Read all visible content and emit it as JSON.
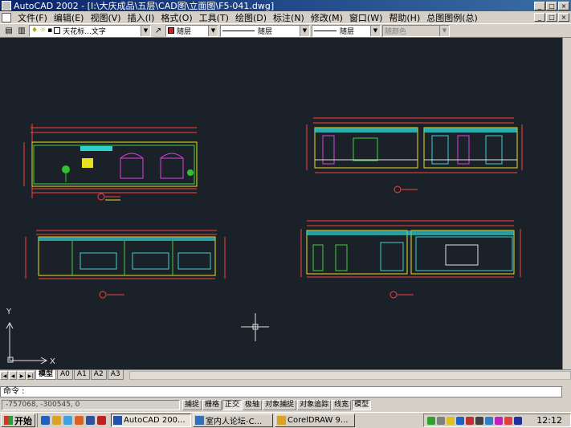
{
  "window": {
    "title": "AutoCAD 2002 - [I:\\大庆成品\\五层\\CAD图\\立面图\\F5-041.dwg]"
  },
  "window_buttons": [
    "_",
    "□",
    "×"
  ],
  "menu": {
    "items": [
      {
        "label": "文件(F)"
      },
      {
        "label": "编辑(E)"
      },
      {
        "label": "视图(V)"
      },
      {
        "label": "插入(I)"
      },
      {
        "label": "格式(O)"
      },
      {
        "label": "工具(T)"
      },
      {
        "label": "绘图(D)"
      },
      {
        "label": "标注(N)"
      },
      {
        "label": "修改(M)"
      },
      {
        "label": "窗口(W)"
      },
      {
        "label": "帮助(H)"
      },
      {
        "label": "总图图例(总)"
      }
    ]
  },
  "toolbar": {
    "layer_value": "天花标...文字",
    "color_value": "随层",
    "linetype_value": "随层",
    "lineweight_value": "随层",
    "plotstyle_value": "随颜色",
    "accent_color": "#d02020"
  },
  "drawing": {
    "background": "#1b2128",
    "ucs_x": "X",
    "ucs_y": "Y"
  },
  "tabs": {
    "nav": [
      "|◀",
      "◀",
      "▶",
      "▶|"
    ],
    "items": [
      {
        "label": "模型",
        "active": true
      },
      {
        "label": "A0"
      },
      {
        "label": "A1"
      },
      {
        "label": "A2"
      },
      {
        "label": "A3"
      }
    ]
  },
  "command": {
    "prompt": "命令 :"
  },
  "status": {
    "coords": "-757068, -300545, 0",
    "buttons": [
      {
        "label": "捕捉",
        "on": false
      },
      {
        "label": "栅格",
        "on": false
      },
      {
        "label": "正交",
        "on": true
      },
      {
        "label": "极轴",
        "on": false
      },
      {
        "label": "对象捕捉",
        "on": false
      },
      {
        "label": "对象追踪",
        "on": false
      },
      {
        "label": "线宽",
        "on": false
      },
      {
        "label": "模型",
        "on": true
      }
    ]
  },
  "taskbar": {
    "start_label": "开始",
    "items": [
      {
        "label": "AutoCAD 200...",
        "active": true,
        "color": "#2050b0"
      },
      {
        "label": "室内人论坛-C...",
        "active": false,
        "color": "#3070c0"
      },
      {
        "label": "CorelDRAW 9...",
        "active": false,
        "color": "#e0a020"
      }
    ],
    "clock": "12:12"
  }
}
